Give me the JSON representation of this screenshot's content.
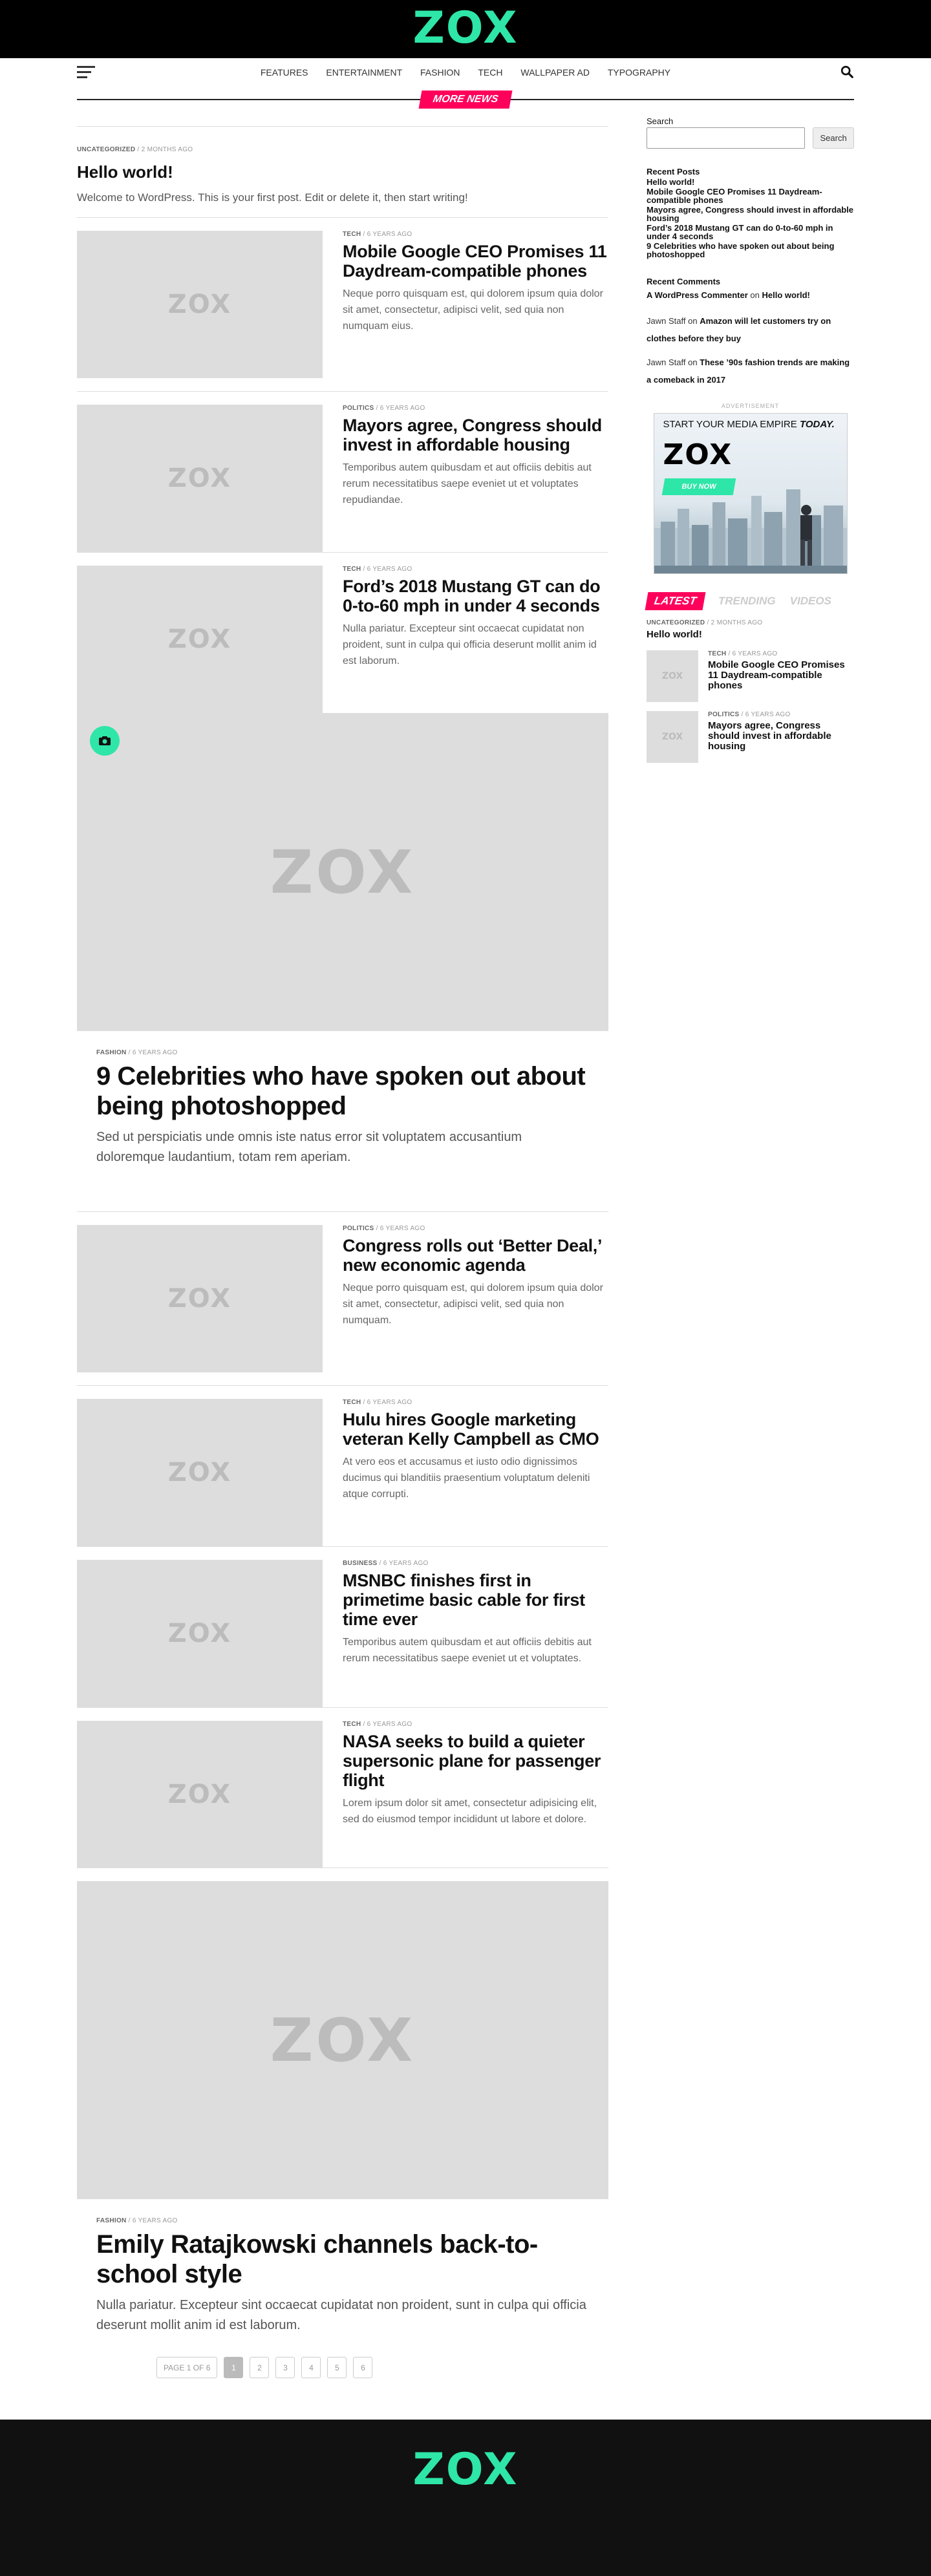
{
  "site": {
    "logo": "ZOX",
    "accent": "#2ee6a8",
    "badge_color": "#ff005b"
  },
  "nav": {
    "items": [
      "FEATURES",
      "ENTERTAINMENT",
      "FASHION",
      "TECH",
      "WALLPAPER AD",
      "TYPOGRAPHY"
    ]
  },
  "more_news": "MORE NEWS",
  "hero": {
    "category": "UNCATEGORIZED",
    "time": "2 months ago",
    "title": "Hello world!",
    "excerpt": "Welcome to WordPress. This is your first post. Edit or delete it, then start writing!"
  },
  "rows_a": [
    {
      "category": "TECH",
      "time": "6 years ago",
      "title": "Mobile Google CEO Promises 11 Daydream-compatible phones",
      "excerpt": "Neque porro quisquam est, qui dolorem ipsum quia dolor sit amet, consectetur, adipisci velit, sed quia non numquam eius."
    },
    {
      "category": "POLITICS",
      "time": "6 years ago",
      "title": "Mayors agree, Congress should invest in affordable housing",
      "excerpt": "Temporibus autem quibusdam et aut officiis debitis aut rerum necessitatibus saepe eveniet ut et voluptates repudiandae."
    },
    {
      "category": "TECH",
      "time": "6 years ago",
      "title": "Ford’s 2018 Mustang GT can do 0-to-60 mph in under 4 seconds",
      "excerpt": "Nulla pariatur. Excepteur sint occaecat cupidatat non proident, sunt in culpa qui officia deserunt mollit anim id est laborum."
    }
  ],
  "feature_1": {
    "category": "FASHION",
    "time": "6 years ago",
    "title": "9 Celebrities who have spoken out about being photoshopped",
    "excerpt": "Sed ut perspiciatis unde omnis iste natus error sit voluptatem accusantium doloremque laudantium, totam rem aperiam."
  },
  "rows_b": [
    {
      "category": "POLITICS",
      "time": "6 years ago",
      "title": "Congress rolls out ‘Better Deal,’ new economic agenda",
      "excerpt": "Neque porro quisquam est, qui dolorem ipsum quia dolor sit amet, consectetur, adipisci velit, sed quia non numquam."
    },
    {
      "category": "TECH",
      "time": "6 years ago",
      "title": "Hulu hires Google marketing veteran Kelly Campbell as CMO",
      "excerpt": "At vero eos et accusamus et iusto odio dignissimos ducimus qui blanditiis praesentium voluptatum deleniti atque corrupti."
    },
    {
      "category": "BUSINESS",
      "time": "6 years ago",
      "title": "MSNBC finishes first in primetime basic cable for first time ever",
      "excerpt": "Temporibus autem quibusdam et aut officiis debitis aut rerum necessitatibus saepe eveniet ut et voluptates."
    },
    {
      "category": "TECH",
      "time": "6 years ago",
      "title": "NASA seeks to build a quieter supersonic plane for passenger flight",
      "excerpt": "Lorem ipsum dolor sit amet, consectetur adipisicing elit, sed do eiusmod tempor incididunt ut labore et dolore."
    }
  ],
  "feature_2": {
    "category": "FASHION",
    "time": "6 years ago",
    "title": "Emily Ratajkowski channels back-to-school style",
    "excerpt": "Nulla pariatur. Excepteur sint occaecat cupidatat non proident, sunt in culpa qui officia deserunt mollit anim id est laborum."
  },
  "pagination": {
    "label": "PAGE 1 OF 6",
    "pages": [
      "1",
      "2",
      "3",
      "4",
      "5",
      "6"
    ],
    "current": "1"
  },
  "sidebar": {
    "search_label": "Search",
    "search_button": "Search",
    "recent_posts_heading": "Recent Posts",
    "recent_posts": [
      "Hello world!",
      "Mobile Google CEO Promises 11 Daydream-compatible phones",
      "Mayors agree, Congress should invest in affordable housing",
      "Ford’s 2018 Mustang GT can do 0-to-60 mph in under 4 seconds",
      "9 Celebrities who have spoken out about being photoshopped"
    ],
    "recent_comments_heading": "Recent Comments",
    "comments": [
      {
        "author": "A WordPress Commenter",
        "on": "on",
        "post": "Hello world!"
      },
      {
        "author": "Jawn Staff",
        "on": "on",
        "post": "Amazon will let customers try on clothes before they buy"
      },
      {
        "author": "Jawn Staff",
        "on": "on",
        "post": "These ’90s fashion trends are making a comeback in 2017"
      }
    ],
    "ad_label": "ADVERTISEMENT",
    "ad_title_1": "START YOUR MEDIA EMPIRE ",
    "ad_title_2": "TODAY.",
    "ad_logo": "ZOX",
    "ad_button": "BUY NOW",
    "tabs": [
      "LATEST",
      "TRENDING",
      "VIDEOS"
    ],
    "latest": {
      "category": "UNCATEGORIZED",
      "time": "2 months ago",
      "title": "Hello world!"
    },
    "mini_posts": [
      {
        "category": "TECH",
        "time": "6 years ago",
        "title": "Mobile Google CEO Promises 11 Daydream-compatible phones"
      },
      {
        "category": "POLITICS",
        "time": "6 years ago",
        "title": "Mayors agree, Congress should invest in affordable housing"
      }
    ]
  },
  "footer": {
    "logo": "ZOX"
  }
}
